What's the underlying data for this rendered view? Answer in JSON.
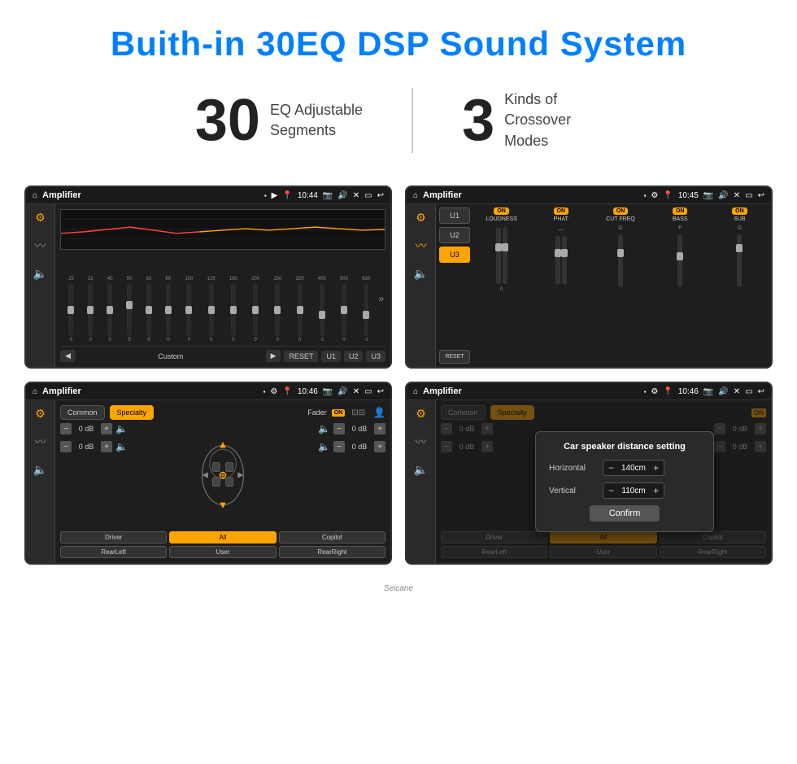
{
  "page": {
    "title": "Buith-in 30EQ DSP Sound System"
  },
  "stats": [
    {
      "number": "30",
      "desc_line1": "EQ Adjustable",
      "desc_line2": "Segments"
    },
    {
      "number": "3",
      "desc_line1": "Kinds of",
      "desc_line2": "Crossover Modes"
    }
  ],
  "screens": [
    {
      "id": "screen1",
      "status_bar": {
        "home": "⌂",
        "title": "Amplifier",
        "icons": "▪ ▶",
        "location": "📍",
        "time": "10:44",
        "extra_icons": "📷 🔊 ✕ ▭ ↩"
      },
      "type": "eq",
      "bands": [
        25,
        32,
        40,
        50,
        63,
        80,
        100,
        125,
        160,
        200,
        250,
        320,
        400,
        500,
        630
      ],
      "values": [
        0,
        0,
        0,
        5,
        0,
        0,
        0,
        0,
        0,
        0,
        0,
        0,
        -1,
        0,
        -1
      ],
      "slider_positions": [
        50,
        50,
        50,
        45,
        50,
        50,
        50,
        50,
        50,
        50,
        50,
        50,
        55,
        50,
        55
      ],
      "preset": "Custom",
      "buttons": [
        "RESET",
        "U1",
        "U2",
        "U3"
      ]
    },
    {
      "id": "screen2",
      "status_bar": {
        "home": "⌂",
        "title": "Amplifier",
        "time": "10:45"
      },
      "type": "crossover",
      "u_buttons": [
        "U1",
        "U2",
        "U3"
      ],
      "active_u": "U3",
      "channels": [
        {
          "name": "LOUDNESS",
          "on": true
        },
        {
          "name": "PHAT",
          "on": true
        },
        {
          "name": "CUT FREQ",
          "on": true
        },
        {
          "name": "BASS",
          "on": true
        },
        {
          "name": "SUB",
          "on": true
        }
      ],
      "reset_label": "RESET"
    },
    {
      "id": "screen3",
      "status_bar": {
        "home": "⌂",
        "title": "Amplifier",
        "time": "10:46"
      },
      "type": "speaker",
      "modes": [
        "Common",
        "Specialty"
      ],
      "active_mode": "Specialty",
      "fader_label": "Fader",
      "fader_on": "ON",
      "db_values": [
        "0 dB",
        "0 dB",
        "0 dB",
        "0 dB"
      ],
      "buttons": [
        "Driver",
        "RearLeft",
        "All",
        "Copilot",
        "User",
        "RearRight"
      ],
      "active_button": "All"
    },
    {
      "id": "screen4",
      "status_bar": {
        "home": "⌂",
        "title": "Amplifier",
        "time": "10:46"
      },
      "type": "speaker_distance",
      "dialog": {
        "title": "Car speaker distance setting",
        "horizontal_label": "Horizontal",
        "horizontal_value": "140cm",
        "vertical_label": "Vertical",
        "vertical_value": "110cm",
        "confirm_label": "Confirm"
      },
      "modes": [
        "Common",
        "Specialty"
      ],
      "active_mode": "Specialty",
      "buttons": [
        "Driver",
        "RearLeft",
        "All",
        "Copilot",
        "User",
        "RearRight"
      ]
    }
  ],
  "watermark": "Seicane"
}
